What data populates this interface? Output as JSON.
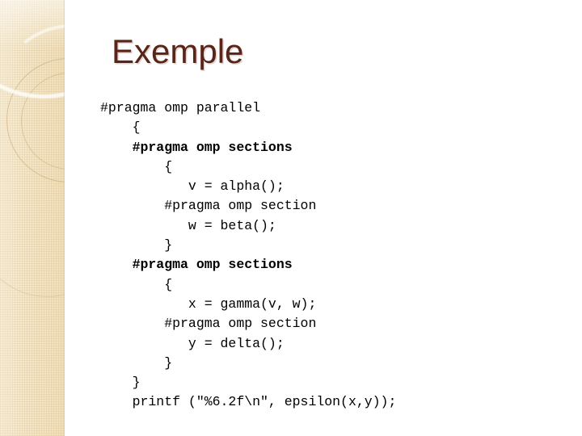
{
  "slide": {
    "title": "Exemple",
    "title_color": "#5a2418",
    "background_color": "#ffffff",
    "sidebar_color": "#f3e4c3",
    "code_color": "#000000"
  },
  "code": {
    "language": "c-openmp",
    "lines": [
      {
        "text": "#pragma omp parallel",
        "bold": false
      },
      {
        "text": "    {",
        "bold": false
      },
      {
        "text": "    #pragma omp sections",
        "bold": true
      },
      {
        "text": "        {",
        "bold": false
      },
      {
        "text": "           v = alpha();",
        "bold": false
      },
      {
        "text": "        #pragma omp section",
        "bold": false
      },
      {
        "text": "           w = beta();",
        "bold": false
      },
      {
        "text": "        }",
        "bold": false
      },
      {
        "text": "    #pragma omp sections",
        "bold": true
      },
      {
        "text": "        {",
        "bold": false
      },
      {
        "text": "           x = gamma(v, w);",
        "bold": false
      },
      {
        "text": "        #pragma omp section",
        "bold": false
      },
      {
        "text": "           y = delta();",
        "bold": false
      },
      {
        "text": "        }",
        "bold": false
      },
      {
        "text": "    }",
        "bold": false
      },
      {
        "text": "    printf (\"%6.2f\\n\", epsilon(x,y));",
        "bold": false
      }
    ]
  },
  "decoration": {
    "ring_color": "#c7a66c",
    "swoosh_color": "#ffffff",
    "band_label": "decorative-side-band"
  }
}
